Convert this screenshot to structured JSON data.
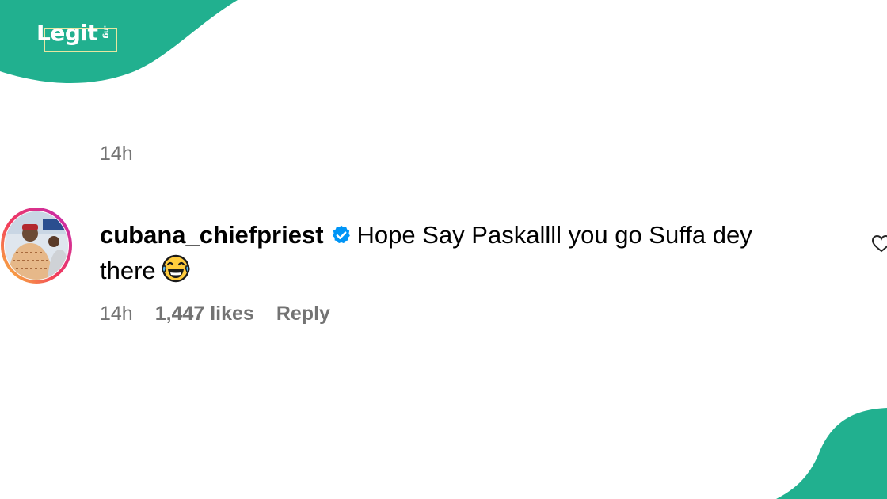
{
  "brand": {
    "logo_text": "Legit",
    "logo_tld": ".ng",
    "accent_color": "#21b08f"
  },
  "post": {
    "timestamp": "14h"
  },
  "comment": {
    "username": "cubana_chiefpriest",
    "verified": true,
    "text_line1": "Hope Say Paskallll you go Suffa dey",
    "text_line2": "there",
    "emoji": "face-with-tears-of-joy",
    "timestamp": "14h",
    "likes": "1,447 likes",
    "reply_label": "Reply"
  },
  "icons": {
    "verified": "verified-badge-icon",
    "like": "heart-icon"
  }
}
